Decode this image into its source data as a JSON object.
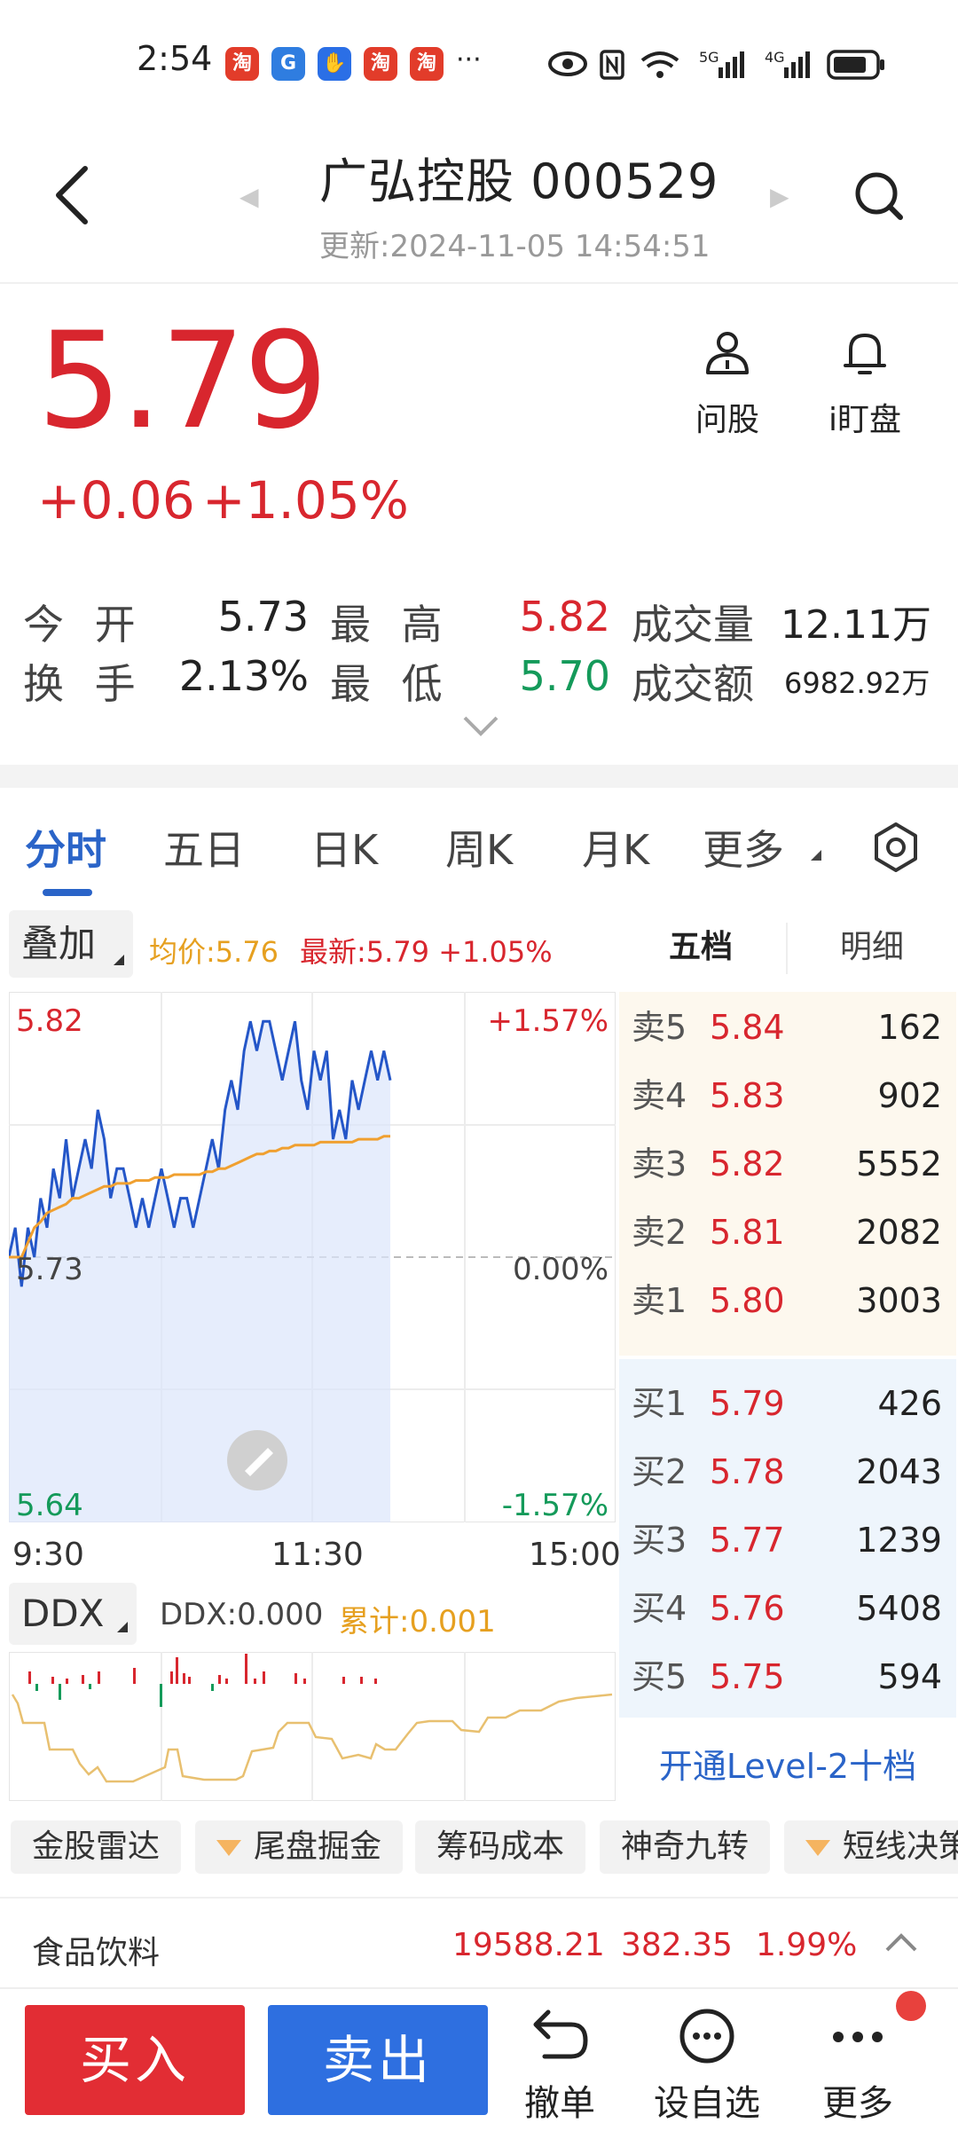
{
  "status_bar": {
    "time": "2:54",
    "app_badges": [
      "淘",
      "G",
      "✋",
      "淘",
      "淘"
    ],
    "overflow": "···",
    "right_icons": [
      "eye-icon",
      "nfc-icon",
      "wifi-icon",
      "signal-5g-icon",
      "signal-4g-icon",
      "battery-icon"
    ],
    "net_5g": "5G",
    "net_4g": "4G"
  },
  "header": {
    "title": "广弘控股 000529",
    "update_time": "更新:2024-11-05 14:54:51"
  },
  "quote": {
    "price": "5.79",
    "change": "+0.06",
    "change_pct": "+1.05%"
  },
  "tools": {
    "ask": "问股",
    "iding": "i盯盘"
  },
  "stats": {
    "open_label": "今 开",
    "open": "5.73",
    "high_label": "最 高",
    "high": "5.82",
    "volume_label": "成交量",
    "volume": "12.11万",
    "turnover_label": "换 手",
    "turnover": "2.13%",
    "low_label": "最 低",
    "low": "5.70",
    "amount_label": "成交额",
    "amount": "6982.92万"
  },
  "tabs": [
    "分时",
    "五日",
    "日K",
    "周K",
    "月K",
    "更多"
  ],
  "chart_header": {
    "overlay": "叠加",
    "avg": "均价:5.76",
    "latest": "最新:5.79 +1.05%",
    "wudang": "五档",
    "mingxi": "明细"
  },
  "chart_axes": {
    "y_top": "5.82",
    "y_mid": "5.73",
    "y_bot": "5.64",
    "pct_top": "+1.57%",
    "pct_mid": "0.00%",
    "pct_bot": "-1.57%",
    "x_start": "9:30",
    "x_mid": "11:30",
    "x_end": "15:00"
  },
  "chart_data": {
    "type": "line",
    "ylim": [
      5.64,
      5.82
    ],
    "series": [
      {
        "values": [
          5.73,
          5.74,
          5.72,
          5.74,
          5.73,
          5.75,
          5.74,
          5.76,
          5.75,
          5.77,
          5.75,
          5.76,
          5.77,
          5.76,
          5.78,
          5.77,
          5.75,
          5.76,
          5.76,
          5.75,
          5.74,
          5.75,
          5.74,
          5.75,
          5.76,
          5.75,
          5.74,
          5.75,
          5.75,
          5.74,
          5.75,
          5.76,
          5.77,
          5.76,
          5.78,
          5.79,
          5.78,
          5.8,
          5.81,
          5.8,
          5.81,
          5.81,
          5.8,
          5.79,
          5.8,
          5.81,
          5.79,
          5.78,
          5.8,
          5.79,
          5.8,
          5.77,
          5.78,
          5.77,
          5.79,
          5.78,
          5.79,
          5.8,
          5.79,
          5.8,
          5.79
        ]
      },
      {
        "values": [
          5.73,
          5.73,
          5.73,
          5.735,
          5.74,
          5.742,
          5.745,
          5.746,
          5.747,
          5.748,
          5.75,
          5.75,
          5.751,
          5.752,
          5.753,
          5.754,
          5.754,
          5.755,
          5.755,
          5.755,
          5.756,
          5.756,
          5.756,
          5.757,
          5.757,
          5.757,
          5.758,
          5.758,
          5.758,
          5.758,
          5.758,
          5.759,
          5.759,
          5.76,
          5.76,
          5.761,
          5.762,
          5.763,
          5.764,
          5.765,
          5.765,
          5.766,
          5.766,
          5.767,
          5.767,
          5.768,
          5.768,
          5.768,
          5.768,
          5.769,
          5.769,
          5.769,
          5.769,
          5.769,
          5.769,
          5.77,
          5.77,
          5.77,
          5.77,
          5.771,
          5.771
        ]
      }
    ]
  },
  "order_book": {
    "sell": [
      {
        "label": "卖5",
        "price": "5.84",
        "vol": "162"
      },
      {
        "label": "卖4",
        "price": "5.83",
        "vol": "902"
      },
      {
        "label": "卖3",
        "price": "5.82",
        "vol": "5552"
      },
      {
        "label": "卖2",
        "price": "5.81",
        "vol": "2082"
      },
      {
        "label": "卖1",
        "price": "5.80",
        "vol": "3003"
      }
    ],
    "buy": [
      {
        "label": "买1",
        "price": "5.79",
        "vol": "426"
      },
      {
        "label": "买2",
        "price": "5.78",
        "vol": "2043"
      },
      {
        "label": "买3",
        "price": "5.77",
        "vol": "1239"
      },
      {
        "label": "买4",
        "price": "5.76",
        "vol": "5408"
      },
      {
        "label": "买5",
        "price": "5.75",
        "vol": "594"
      }
    ],
    "level2": "开通Level-2十档"
  },
  "ddx": {
    "button": "DDX",
    "value": "DDX:0.000",
    "cumulative": "累计:0.001"
  },
  "chips": [
    "金股雷达",
    "尾盘掘金",
    "筹码成本",
    "神奇九转",
    "短线决策"
  ],
  "sector": {
    "name": "食品饮料",
    "index": "19588.21",
    "change": "382.35",
    "pct": "1.99%"
  },
  "bottom": {
    "buy": "买入",
    "sell": "卖出",
    "cancel": "撤单",
    "watch": "设自选",
    "more": "更多"
  },
  "colors": {
    "up_red": "#d8262e",
    "down_green": "#149a5a",
    "accent_blue": "#2a64c8",
    "avg_orange": "#e6a020"
  }
}
